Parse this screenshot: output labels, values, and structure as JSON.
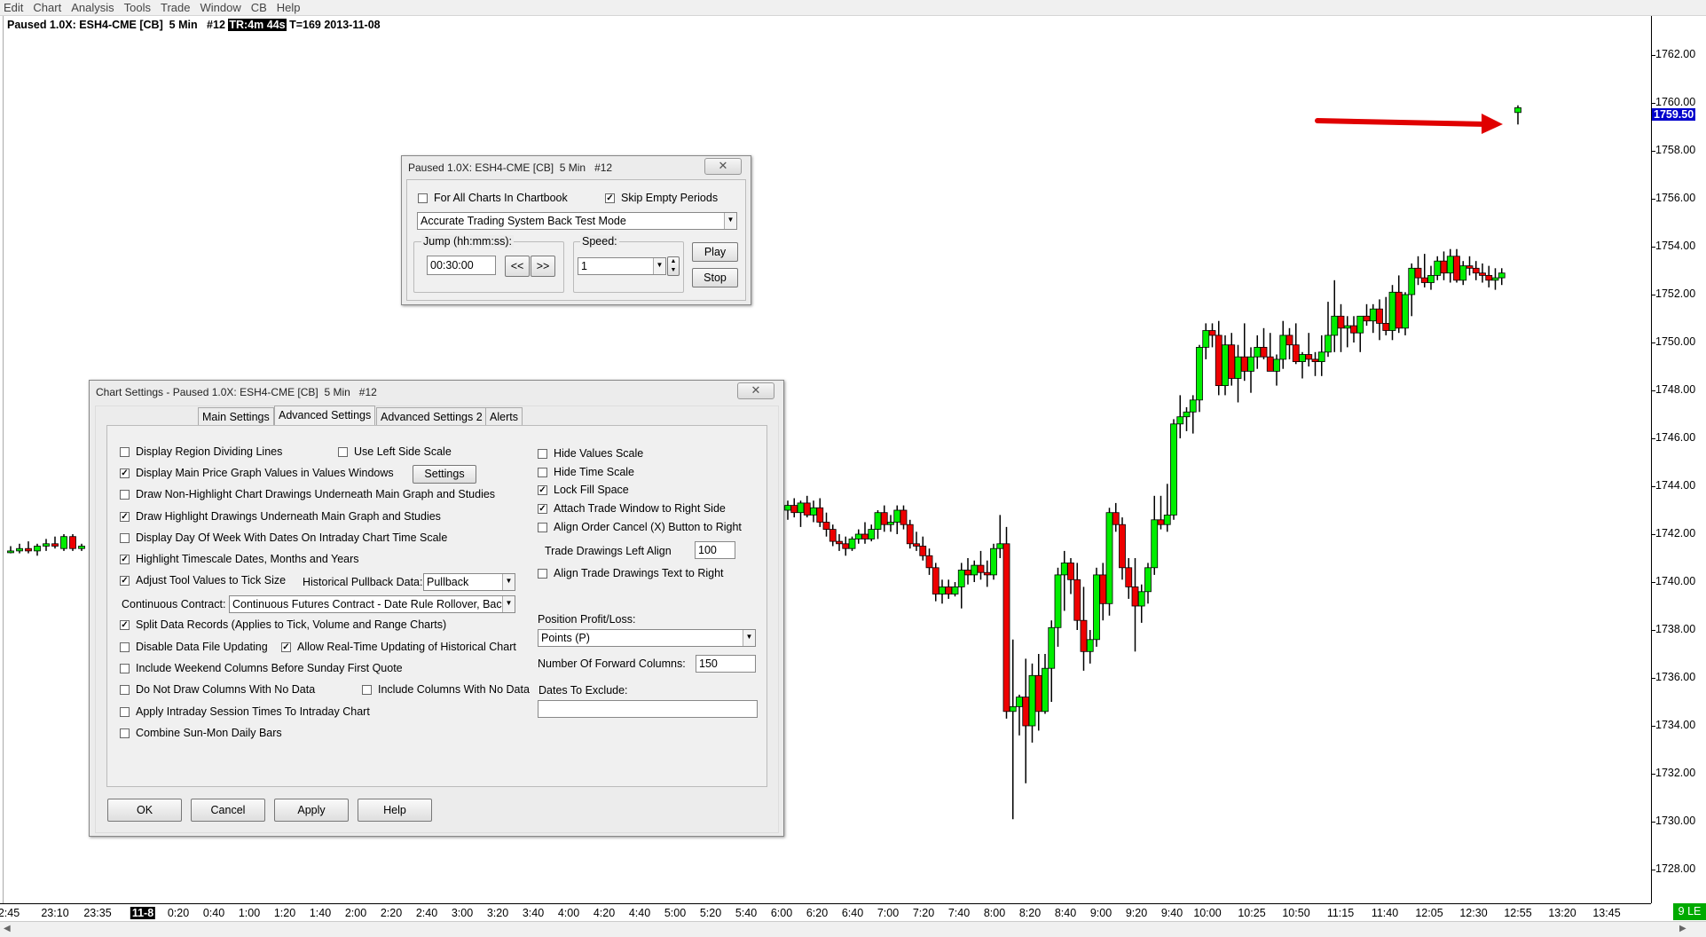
{
  "menu": [
    "Edit",
    "Chart",
    "Analysis",
    "Tools",
    "Trade",
    "Window",
    "CB",
    "Help"
  ],
  "chart": {
    "header_pre": "Paused 1.0X: ESH4-CME [CB]  5 Min   #12 ",
    "header_tr": "TR:4m 44s",
    "header_post": " T=169 2013-11-08",
    "current_price": "1759.50",
    "price_labels": [
      "1762.00",
      "1760.00",
      "1758.00",
      "1756.00",
      "1754.00",
      "1752.00",
      "1750.00",
      "1748.00",
      "1746.00",
      "1744.00",
      "1742.00",
      "1740.00",
      "1738.00",
      "1736.00",
      "1734.00",
      "1732.00",
      "1730.00",
      "1728.00"
    ],
    "time_labels": [
      "2:45",
      "23:10",
      "23:35",
      "11-8",
      "0:20",
      "0:40",
      "1:00",
      "1:20",
      "1:40",
      "2:00",
      "2:20",
      "2:40",
      "3:00",
      "3:20",
      "3:40",
      "4:00",
      "4:20",
      "4:40",
      "5:00",
      "5:20",
      "5:40",
      "6:00",
      "6:20",
      "6:40",
      "7:00",
      "7:20",
      "7:40",
      "8:00",
      "8:20",
      "8:40",
      "9:00",
      "9:20",
      "9:40",
      "10:00",
      "10:25",
      "10:50",
      "11:15",
      "11:40",
      "12:05",
      "12:30",
      "12:55",
      "13:20",
      "13:45"
    ],
    "highlight_time": "11-8",
    "status_box": "9 LE",
    "colors": {
      "up": "#00ee00",
      "down": "#ee0000",
      "arrow": "#e00000",
      "price_box": "#0000cc"
    }
  },
  "replay_dialog": {
    "title": "Paused 1.0X: ESH4-CME [CB]  5 Min   #12",
    "close": "✕",
    "for_all_charts": "For All Charts In Chartbook",
    "for_all_charts_checked": false,
    "skip_empty": "Skip Empty Periods",
    "skip_empty_checked": true,
    "mode": "Accurate Trading System Back Test Mode",
    "jump_label": "Jump (hh:mm:ss):",
    "jump_value": "00:30:00",
    "back_btn": "<<",
    "fwd_btn": ">>",
    "speed_label": "Speed:",
    "speed_value": "1",
    "play": "Play",
    "stop": "Stop"
  },
  "settings_dialog": {
    "title": "Chart Settings - Paused 1.0X: ESH4-CME [CB]  5 Min   #12",
    "close": "✕",
    "tabs": [
      "Main Settings",
      "Advanced Settings",
      "Advanced Settings 2",
      "Alerts"
    ],
    "active_tab": "Advanced Settings",
    "left_checks": [
      {
        "label": "Display Region Dividing Lines",
        "checked": false
      },
      {
        "label": "Display Main Price Graph Values in Values Windows",
        "checked": true
      },
      {
        "label": "Draw Non-Highlight Chart Drawings Underneath Main Graph and Studies",
        "checked": false
      },
      {
        "label": "Draw Highlight Drawings Underneath Main Graph and Studies",
        "checked": true
      },
      {
        "label": "Display Day Of Week With Dates On Intraday Chart Time Scale",
        "checked": false
      },
      {
        "label": "Highlight Timescale Dates, Months and Years",
        "checked": true
      },
      {
        "label": "Adjust Tool Values to Tick Size",
        "checked": true
      }
    ],
    "use_left_scale": "Use Left Side Scale",
    "settings_btn": "Settings",
    "hist_pullback_label": "Historical Pullback Data:",
    "hist_pullback_value": "Pullback",
    "continuous_label": "Continuous Contract:",
    "continuous_value": "Continuous Futures Contract - Date Rule Rollover, Back",
    "lower_checks": [
      {
        "label": "Split Data Records (Applies to Tick, Volume and Range Charts)",
        "checked": true
      },
      {
        "label": "Disable Data File Updating",
        "checked": false
      },
      {
        "label": "Include Weekend Columns Before Sunday First Quote",
        "checked": false
      },
      {
        "label": "Do Not Draw Columns With No Data",
        "checked": false
      },
      {
        "label": "Apply Intraday Session Times To Intraday Chart",
        "checked": false
      },
      {
        "label": "Combine Sun-Mon Daily Bars",
        "checked": false
      }
    ],
    "allow_realtime": "Allow Real-Time Updating of Historical Chart",
    "include_no_data": "Include Columns With No Data",
    "right_checks": [
      {
        "label": "Hide Values Scale",
        "checked": false
      },
      {
        "label": "Hide Time Scale",
        "checked": false
      },
      {
        "label": "Lock Fill Space",
        "checked": true
      },
      {
        "label": "Attach Trade Window to Right Side",
        "checked": true
      },
      {
        "label": "Align Order Cancel (X) Button to Right",
        "checked": false
      }
    ],
    "trade_left_align_label": "Trade Drawings Left Align",
    "trade_left_align_value": "100",
    "align_trade_text": "Align Trade Drawings Text to Right",
    "position_pl_label": "Position Profit/Loss:",
    "position_pl_value": "Points (P)",
    "forward_cols_label": "Number Of Forward Columns:",
    "forward_cols_value": "150",
    "dates_exclude_label": "Dates To Exclude:",
    "dates_exclude_value": "",
    "ok": "OK",
    "cancel": "Cancel",
    "apply": "Apply",
    "help": "Help"
  }
}
